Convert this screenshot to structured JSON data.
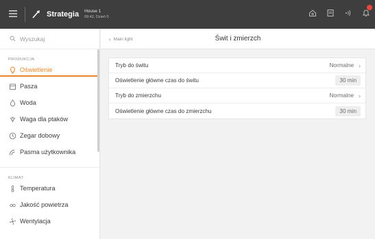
{
  "topbar": {
    "app_title": "Strategia",
    "house_name": "House 1",
    "house_info": "09:42, Dzień 0",
    "icons": [
      "menu-icon",
      "logo-icon",
      "home-icon",
      "document-icon",
      "signal-icon",
      "bell-icon"
    ]
  },
  "sidebar": {
    "search_placeholder": "Wyszukaj",
    "sections": [
      {
        "label": "PRODUKCJA",
        "items": [
          {
            "label": "Oświetlenie",
            "icon": "lightbulb-icon",
            "active": true
          },
          {
            "label": "Pasza",
            "icon": "feed-icon"
          },
          {
            "label": "Woda",
            "icon": "water-drop-icon"
          },
          {
            "label": "Waga dla ptaków",
            "icon": "bird-weight-icon"
          },
          {
            "label": "Zegar dobowy",
            "icon": "clock-icon"
          },
          {
            "label": "Pasma użytkownika",
            "icon": "user-bands-icon"
          }
        ]
      },
      {
        "label": "KLIMAT",
        "items": [
          {
            "label": "Temperatura",
            "icon": "thermometer-icon"
          },
          {
            "label": "Jakość powietrza",
            "icon": "air-quality-icon"
          },
          {
            "label": "Wentylacja",
            "icon": "ventilation-icon"
          }
        ]
      }
    ]
  },
  "main": {
    "back_label": "Main light",
    "title": "Świt i zmierzch",
    "rows": [
      {
        "label": "Tryb do świtu",
        "value": "Normalne"
      },
      {
        "label": "Oświetlenie główne czas do świtu",
        "value": "30 min"
      },
      {
        "label": "Tryb do zmierzchu",
        "value": "Normalne"
      },
      {
        "label": "Oświetlenie główne czas do zmierzchu",
        "value": "30 min"
      }
    ]
  },
  "colors": {
    "topbar_bg": "#3e3e3e",
    "accent": "#e8872a",
    "badge": "#e8453c",
    "page_bg": "#f2f2f2"
  }
}
